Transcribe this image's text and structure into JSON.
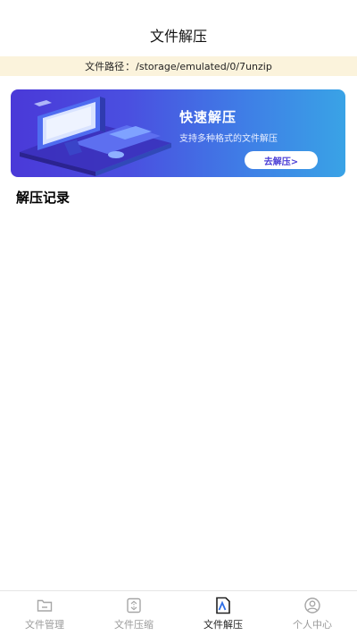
{
  "header": {
    "title": "文件解压"
  },
  "path_bar": {
    "label": "文件路径",
    "separator": "：",
    "value": "/storage/emulated/0/7unzip"
  },
  "banner": {
    "title": "快速解压",
    "subtitle": "支持多种格式的文件解压",
    "button_label": "去解压>",
    "icon": "computer-illustration"
  },
  "section": {
    "title": "解压记录"
  },
  "tabbar": {
    "active_index": 2,
    "tabs": [
      {
        "label": "文件管理",
        "icon": "folder-icon"
      },
      {
        "label": "文件压缩",
        "icon": "zip-file-icon"
      },
      {
        "label": "文件解压",
        "icon": "unzip-file-icon"
      },
      {
        "label": "个人中心",
        "icon": "user-icon"
      }
    ]
  },
  "colors": {
    "banner_start": "#4a39d8",
    "banner_end": "#39a3e6",
    "path_bg": "#fbf3dc",
    "inactive_tab": "#9a9a9a"
  }
}
